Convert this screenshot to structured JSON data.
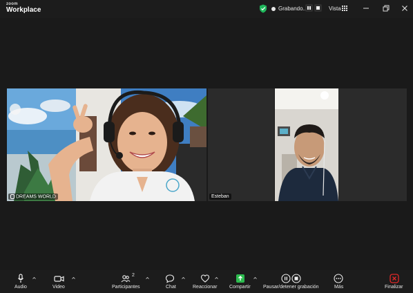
{
  "app": {
    "logo_top": "zoom",
    "logo_bottom": "Workplace"
  },
  "titlebar": {
    "recording_label": "Grabando...",
    "view_label": "Vista"
  },
  "participants": [
    {
      "name": "DREAMS WORLD"
    },
    {
      "name": "Esteban"
    }
  ],
  "toolbar": {
    "audio": "Audio",
    "video": "Video",
    "participants": "Participantes",
    "participants_count": "2",
    "chat": "Chat",
    "react": "Reaccionar",
    "share": "Compartir",
    "record": "Pausar/detener grabación",
    "more": "Más",
    "end": "Finalizar"
  },
  "colors": {
    "share_green": "#2dbb4f",
    "end_red": "#e02828",
    "shield_green": "#1fb75b"
  }
}
